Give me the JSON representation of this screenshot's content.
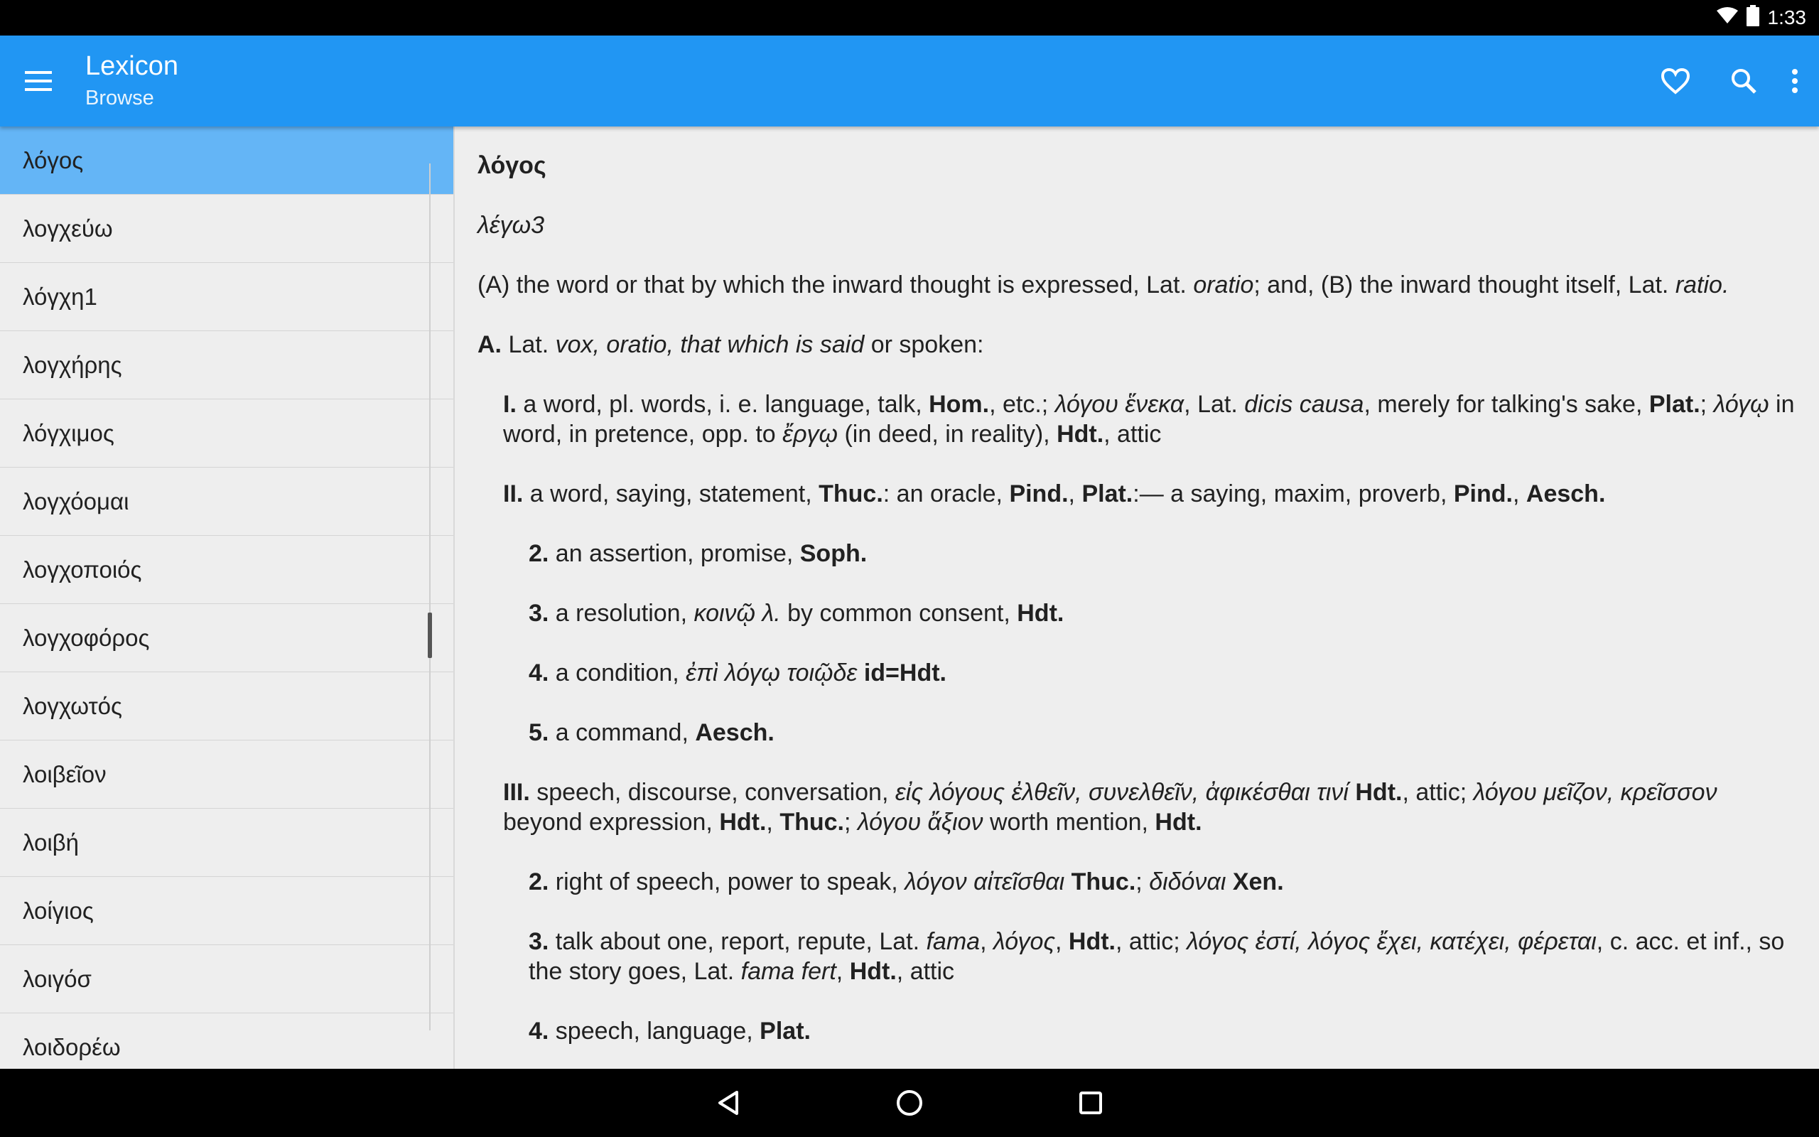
{
  "status": {
    "time": "1:33"
  },
  "appbar": {
    "title": "Lexicon",
    "subtitle": "Browse",
    "icons": [
      "menu-icon",
      "heart-icon",
      "search-icon",
      "more-vert-icon"
    ]
  },
  "colors": {
    "appbar": "#2196f3",
    "selected": "#64b5f6",
    "background": "#eeeeee"
  },
  "wordlist": [
    "λόγος",
    "λογχεύω",
    "λόγχη1",
    "λογχήρης",
    "λόγχιμος",
    "λογχόομαι",
    "λογχοποιός",
    "λογχοφόρος",
    "λογχωτός",
    "λοιβεῖον",
    "λοιβή",
    "λοίγιος",
    "λοιγόσ",
    "λοιδορέω"
  ],
  "entry": {
    "headword": "λόγος",
    "etymology": "λέγω3",
    "summary": {
      "a": "(A) the word or that by which the inward thought is expressed, Lat. ",
      "a_it": "oratio",
      "b": ";  and, (B) the inward thought itself, Lat. ",
      "b_it": "ratio."
    },
    "sectionA": {
      "num": "A.",
      "t1": " Lat. ",
      "it": "vox, oratio, that which is said",
      "t2": " or spoken:"
    },
    "I": {
      "num": "I.",
      "t1": " a word, pl. words, i. e. language, talk, ",
      "b1": "Hom.",
      "t2": ", etc.;  ",
      "g1": "λόγου ἕνεκα",
      "t3": ", Lat. ",
      "l1": "dicis causa",
      "t4": ", merely for talking's sake, ",
      "b2": "Plat.",
      "t5": "; ",
      "g2": "λόγῳ",
      "t6": " in word, in pretence, opp. to  ",
      "g3": "ἔργῳ",
      "t7": " (in deed, in reality), ",
      "b3": "Hdt.",
      "t8": ", attic"
    },
    "II": {
      "num": "II.",
      "t1": " a word, saying, statement, ",
      "b1": "Thuc.",
      "t2": ": an oracle, ",
      "b2": "Pind.",
      "t3": ", ",
      "b3": "Plat.",
      "t4": ":— a saying, maxim, proverb, ",
      "b4": "Pind.",
      "t5": ", ",
      "b5": "Aesch."
    },
    "II2": {
      "num": "2.",
      "t1": " an assertion, promise, ",
      "b1": "Soph."
    },
    "II3": {
      "num": "3.",
      "t1": " a resolution, ",
      "g1": "κοινῷ λ.",
      "t2": " by common consent, ",
      "b1": "Hdt."
    },
    "II4": {
      "num": "4.",
      "t1": " a condition, ",
      "g1": "ἐπὶ λόγῳ τοιῷδε",
      "t2": " ",
      "b1": "id=Hdt."
    },
    "II5": {
      "num": "5.",
      "t1": " a command, ",
      "b1": "Aesch."
    },
    "III": {
      "num": "III.",
      "t1": " speech, discourse, conversation, ",
      "g1": "εἰς λόγους ἐλθεῖν, συνελθεῖν, ἀφικέσθαι τινί",
      "t2": " ",
      "b1": "Hdt.",
      "t3": ", attic; ",
      "g2": "λόγου μεῖζον, κρεῖσσον",
      "t4": " beyond expression, ",
      "b2": "Hdt.",
      "t5": ", ",
      "b3": "Thuc.",
      "t6": "; ",
      "g3": "λόγου ἄξιον",
      "t7": " worth mention, ",
      "b4": "Hdt."
    },
    "III2": {
      "num": "2.",
      "t1": " right of speech, power to speak, ",
      "g1": "λόγον αἰτεῖσθαι",
      "t2": " ",
      "b1": "Thuc.",
      "t3": ";  ",
      "g2": "διδόναι",
      "t4": " ",
      "b2": "Xen."
    },
    "III3": {
      "num": "3.",
      "t1": " talk about one, report, repute, Lat. ",
      "l1": "fama",
      "t2": ", ",
      "g1": "λόγος",
      "t3": ", ",
      "b1": "Hdt.",
      "t4": ", attic;  ",
      "g2": "λόγος ἐστί, λόγος ἔχει, κατέχει, φέρεται",
      "t5": ", c. acc. et inf., so the story goes, Lat. ",
      "l2": "fama fert",
      "t6": ", ",
      "b2": "Hdt.",
      "t7": ", attic"
    },
    "III4": {
      "num": "4.",
      "t1": " speech, language, ",
      "b1": "Plat."
    }
  }
}
